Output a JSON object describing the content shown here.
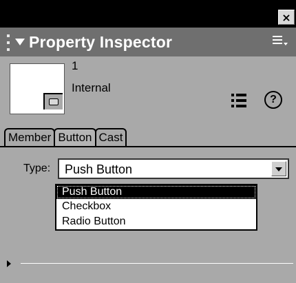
{
  "window": {
    "close_glyph": "×"
  },
  "titlebar": {
    "title": "Property Inspector",
    "collapse_icon": "triangle-down-icon",
    "menu_icon": "options-menu-icon"
  },
  "member": {
    "number": "1",
    "cast": "Internal"
  },
  "tools": {
    "list_icon": "list-view-icon",
    "help_label": "?"
  },
  "tabs": [
    {
      "label": "Member",
      "active": false
    },
    {
      "label": "Button",
      "active": true
    },
    {
      "label": "Cast",
      "active": false
    }
  ],
  "type_field": {
    "label": "Type:",
    "value": "Push Button",
    "options": [
      "Push Button",
      "Checkbox",
      "Radio Button"
    ],
    "selected_index": 0
  },
  "colors": {
    "panel_bg": "#a9a9a9",
    "titlebar_bg": "#6f6f6f",
    "selection_bg": "#000000"
  }
}
